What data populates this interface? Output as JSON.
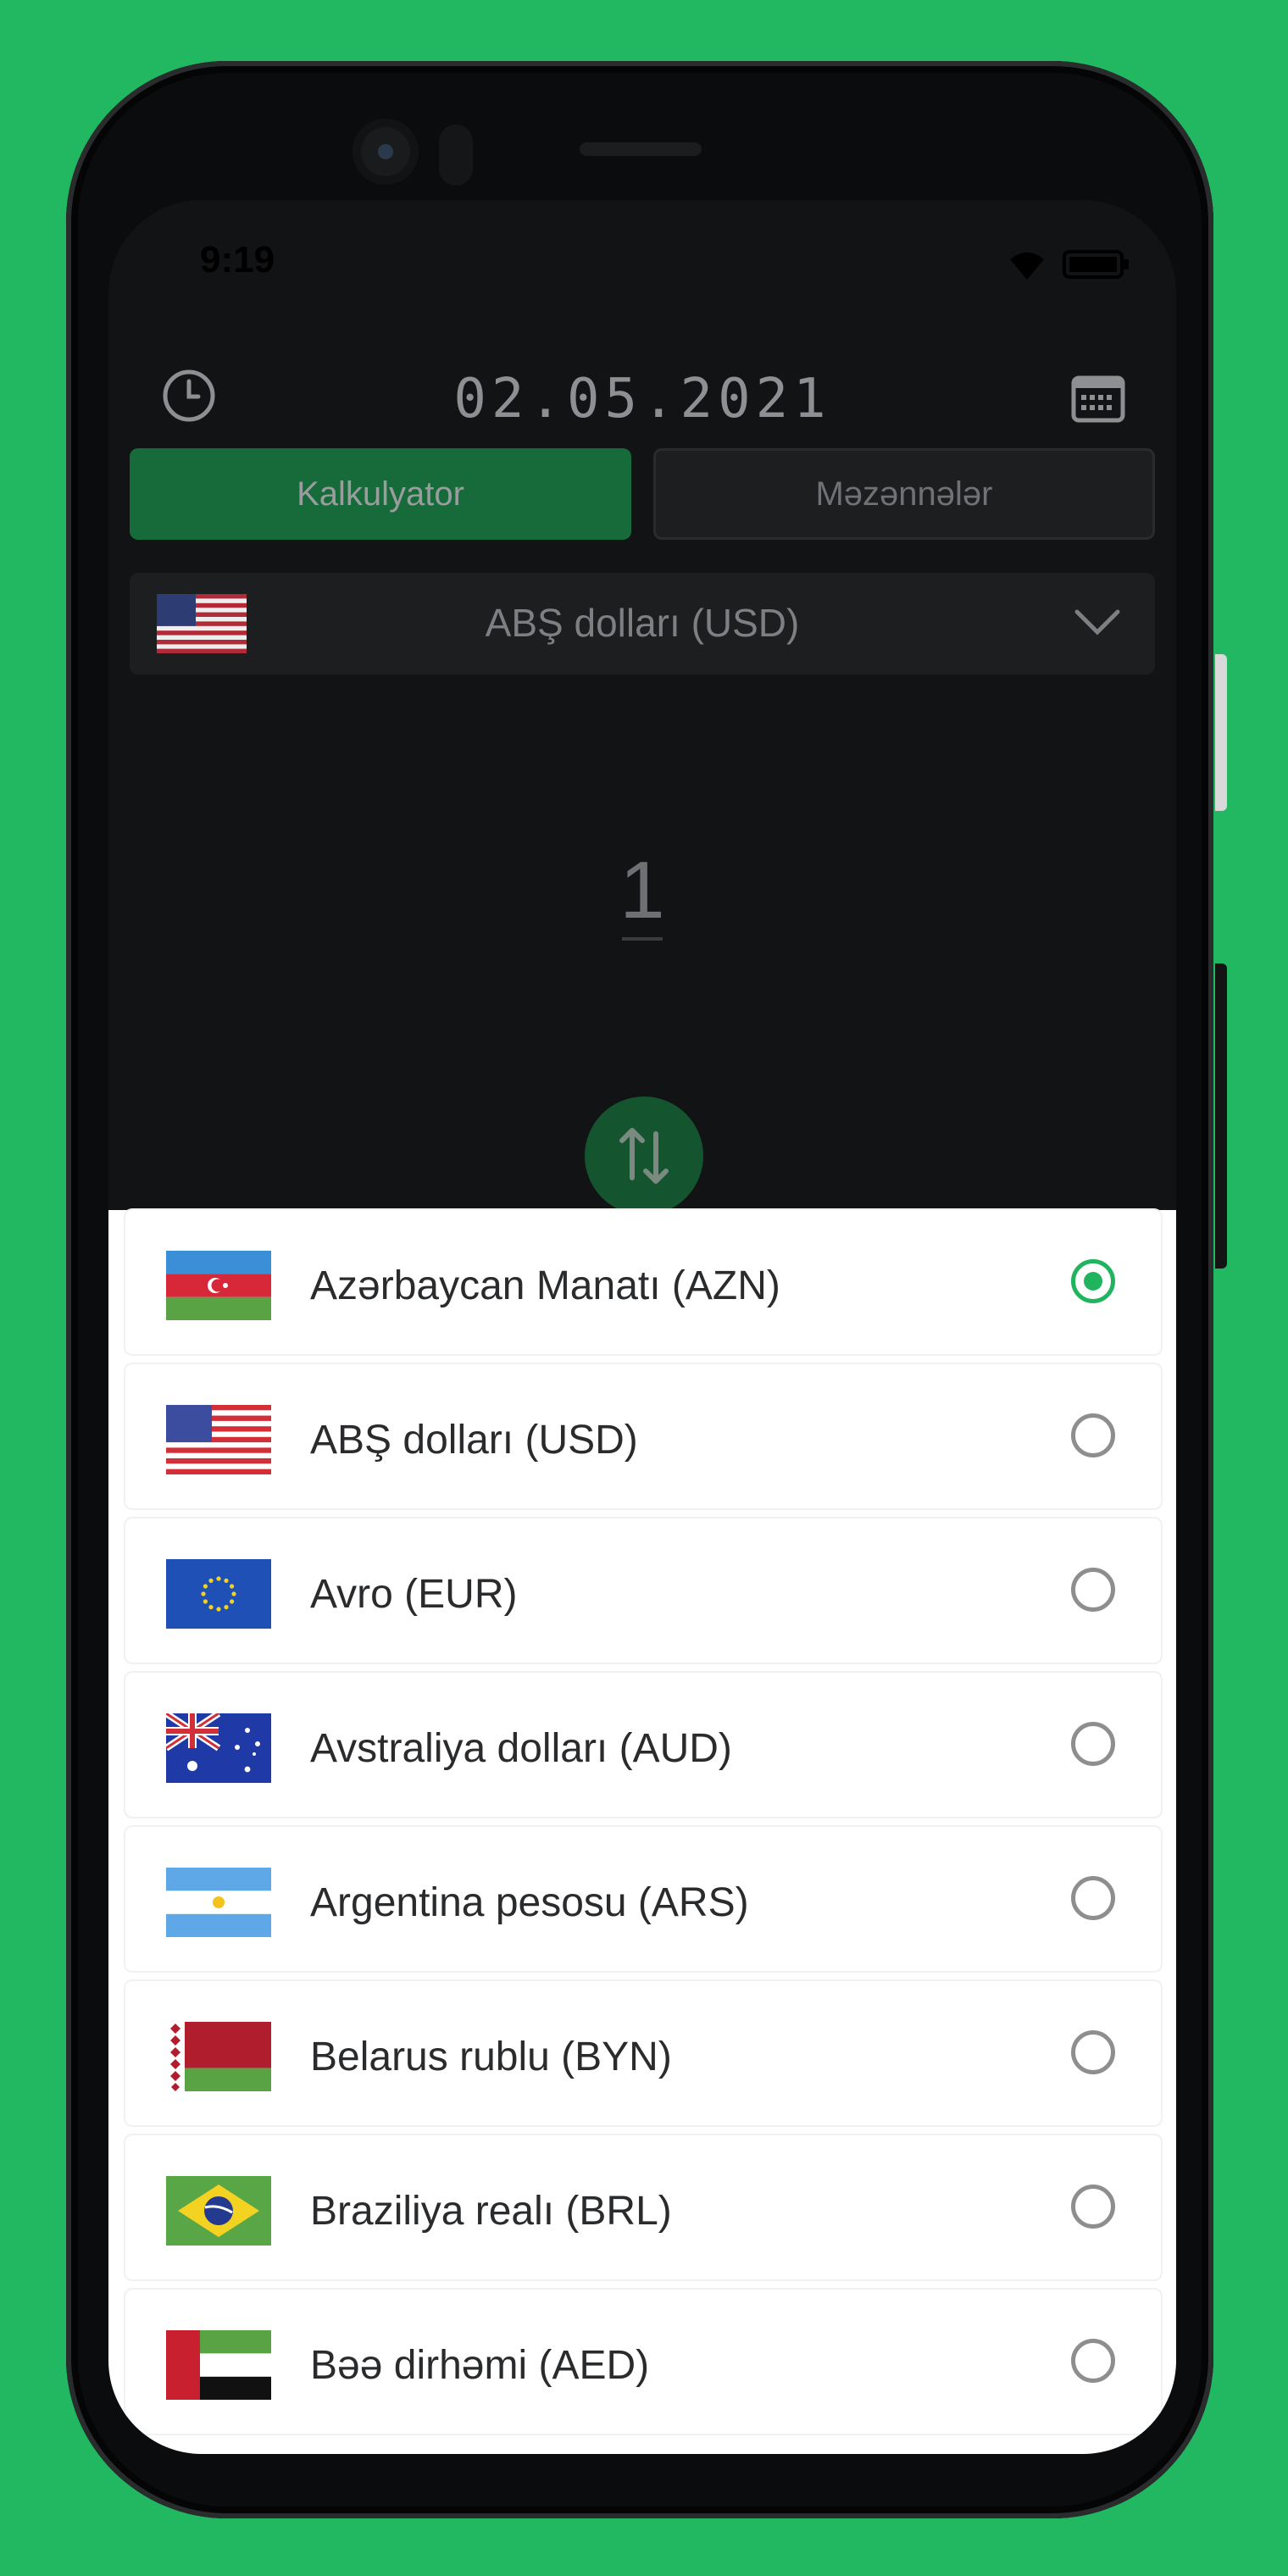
{
  "status_bar": {
    "time": "9:19"
  },
  "header": {
    "date": "02.05.2021"
  },
  "tabs": [
    {
      "label": "Kalkulyator"
    },
    {
      "label": "Məzənnələr"
    }
  ],
  "selector": {
    "label": "ABŞ dolları (USD)"
  },
  "amount": {
    "value": "1"
  },
  "currencies": [
    {
      "label": "Azərbaycan Manatı (AZN)",
      "selected": true
    },
    {
      "label": "ABŞ dolları (USD)",
      "selected": false
    },
    {
      "label": "Avro (EUR)",
      "selected": false
    },
    {
      "label": "Avstraliya dolları (AUD)",
      "selected": false
    },
    {
      "label": "Argentina pesosu (ARS)",
      "selected": false
    },
    {
      "label": "Belarus rublu (BYN)",
      "selected": false
    },
    {
      "label": "Braziliya realı (BRL)",
      "selected": false
    },
    {
      "label": "Bəə dirhəmi (AED)",
      "selected": false
    }
  ],
  "colors": {
    "accent": "#20b45f",
    "background": "#22b862",
    "screen": "#121315"
  }
}
